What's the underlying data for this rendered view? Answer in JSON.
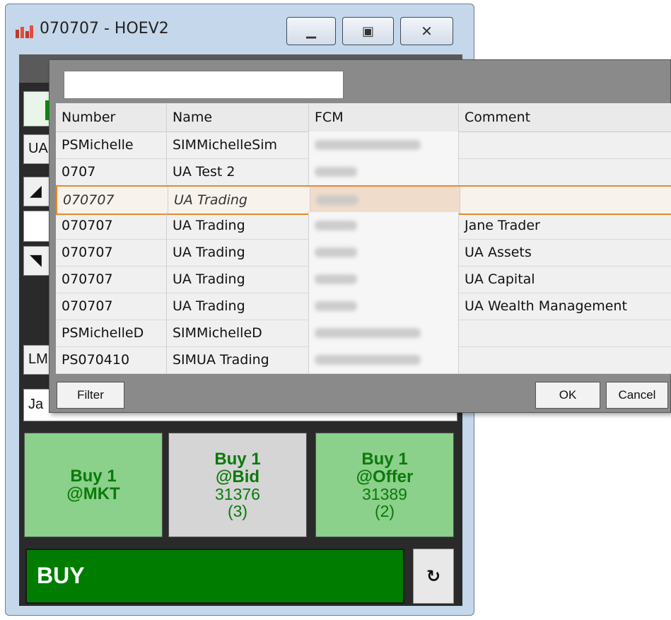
{
  "window": {
    "title": "070707 - HOEV2",
    "minimize_glyph": "▁",
    "maximize_glyph": "▣",
    "close_glyph": "✕"
  },
  "left_panel": {
    "field1": "UA",
    "arrow_up": "◢",
    "arrow_down": "◥",
    "lm_button": "LM",
    "account_field": "Ja"
  },
  "picker": {
    "search_value": "",
    "columns": [
      "Number",
      "Name",
      "FCM",
      "Comment"
    ],
    "rows": [
      {
        "number": "PSMichelle",
        "name": "SIMMichelleSim",
        "comment": ""
      },
      {
        "number": "0707",
        "name": "UA Test 2",
        "comment": ""
      },
      {
        "number": "070707",
        "name": "UA Trading",
        "comment": "",
        "selected": true
      },
      {
        "number": "070707",
        "name": "UA Trading",
        "comment": "Jane Trader"
      },
      {
        "number": "070707",
        "name": "UA Trading",
        "comment": "UA Assets"
      },
      {
        "number": "070707",
        "name": "UA Trading",
        "comment": "UA Capital"
      },
      {
        "number": "070707",
        "name": "UA Trading",
        "comment": "UA Wealth Management"
      },
      {
        "number": "PSMichelleD",
        "name": "SIMMichelleD",
        "comment": ""
      },
      {
        "number": "PS070410",
        "name": "SIMUA Trading",
        "comment": ""
      }
    ],
    "filter_label": "Filter",
    "ok_label": "OK",
    "cancel_label": "Cancel"
  },
  "order_buttons": [
    {
      "line1": "Buy 1",
      "line2": "@MKT",
      "price": "",
      "qty": ""
    },
    {
      "line1": "Buy 1",
      "line2": "@Bid",
      "price": "31376",
      "qty": "(3)"
    },
    {
      "line1": "Buy 1",
      "line2": "@Offer",
      "price": "31389",
      "qty": "(2)"
    }
  ],
  "buy_bar": {
    "label": "BUY",
    "refresh_glyph": "↻"
  },
  "colors": {
    "buy_green": "#007c00",
    "button_green": "#8bd08b",
    "selection_border": "#e8882a"
  }
}
